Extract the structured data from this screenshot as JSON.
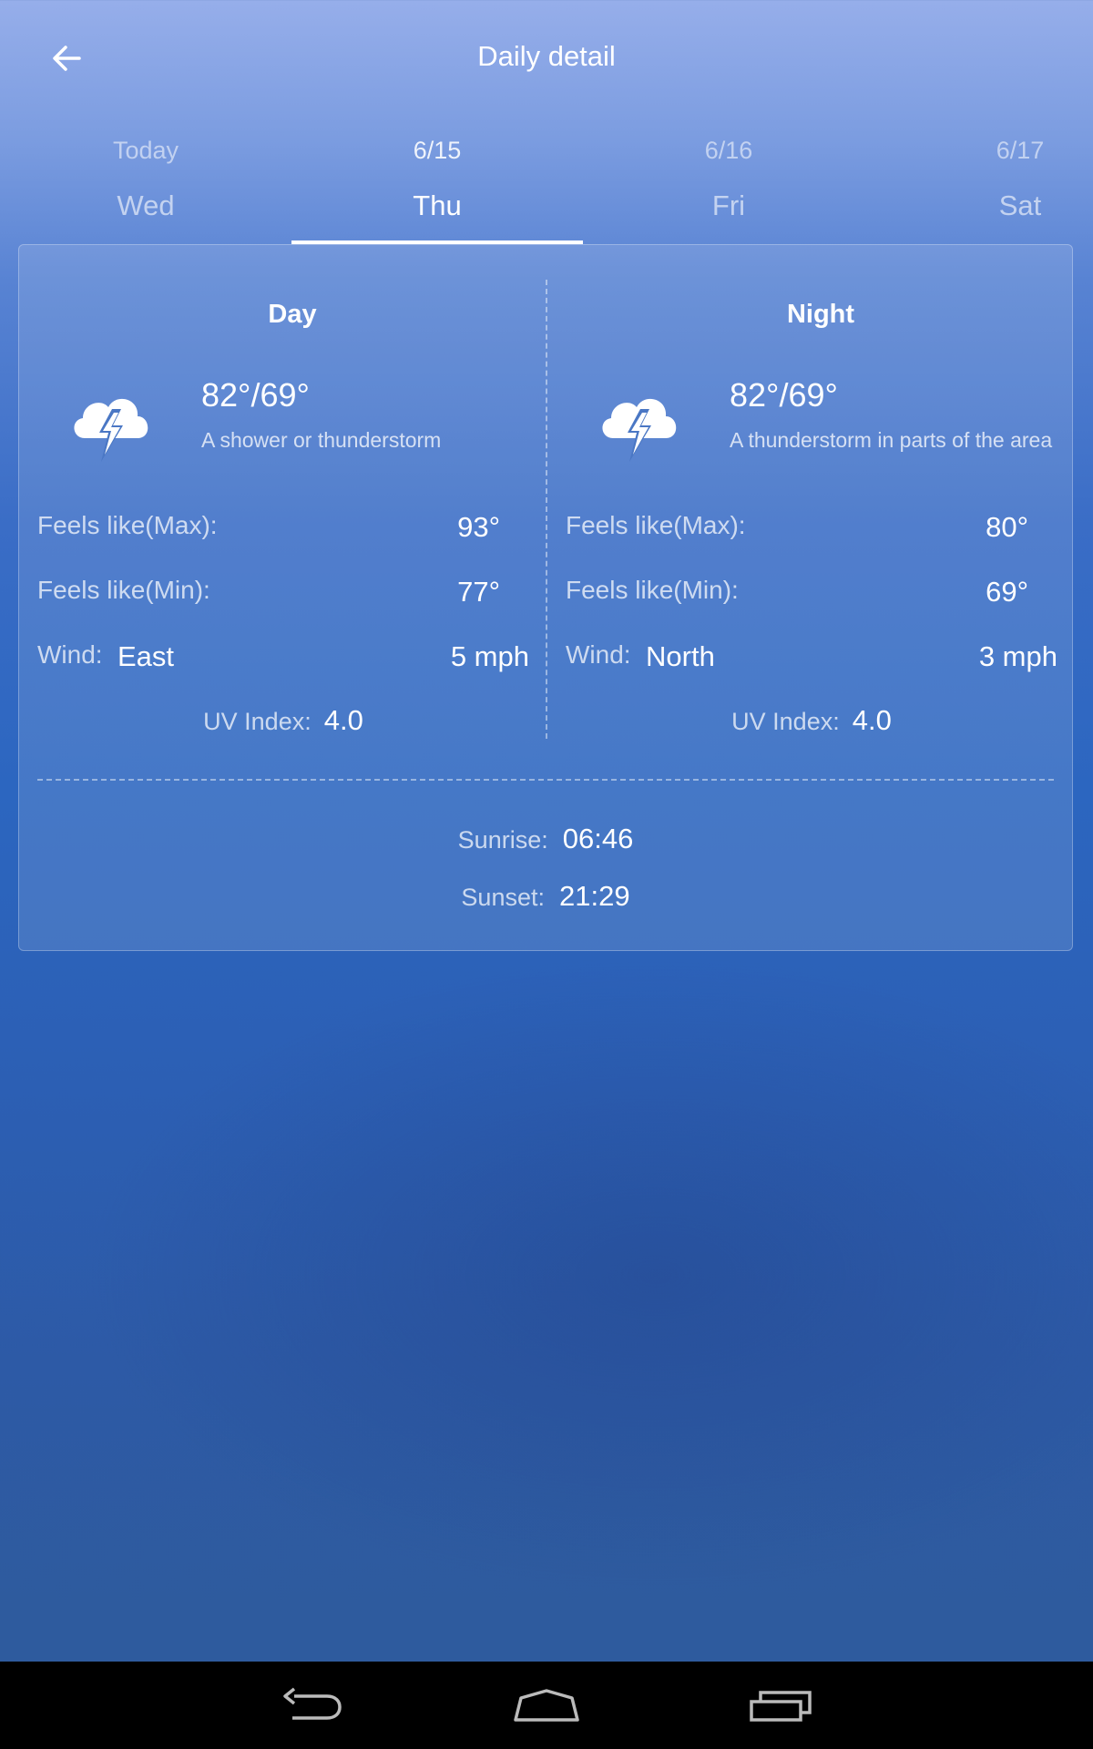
{
  "header": {
    "title": "Daily detail",
    "back_icon": "arrow-left-icon"
  },
  "tabs": [
    {
      "date": "Today",
      "day": "Wed",
      "active": false
    },
    {
      "date": "6/15",
      "day": "Thu",
      "active": true
    },
    {
      "date": "6/16",
      "day": "Fri",
      "active": false
    },
    {
      "date": "6/17",
      "day": "Sat",
      "active": false
    }
  ],
  "day": {
    "heading": "Day",
    "icon": "thunderstorm-cloud-icon",
    "temp": "82°/69°",
    "description": "A shower or thunderstorm",
    "feels_max_label": "Feels like(Max):",
    "feels_max": "93°",
    "feels_min_label": "Feels like(Min):",
    "feels_min": "77°",
    "wind_label": "Wind:",
    "wind_dir": "East",
    "wind_speed": "5 mph",
    "uv_label": "UV Index:",
    "uv": "4.0"
  },
  "night": {
    "heading": "Night",
    "icon": "thunderstorm-cloud-icon",
    "temp": "82°/69°",
    "description": "A thunderstorm in parts of the area",
    "feels_max_label": "Feels like(Max):",
    "feels_max": "80°",
    "feels_min_label": "Feels like(Min):",
    "feels_min": "69°",
    "wind_label": "Wind:",
    "wind_dir": "North",
    "wind_speed": "3 mph",
    "uv_label": "UV Index:",
    "uv": "4.0"
  },
  "sun": {
    "sunrise_label": "Sunrise:",
    "sunrise": "06:46",
    "sunset_label": "Sunset:",
    "sunset": "21:29"
  },
  "navbar": {
    "back_icon": "nav-back-icon",
    "home_icon": "nav-home-icon",
    "recents_icon": "nav-recents-icon"
  }
}
